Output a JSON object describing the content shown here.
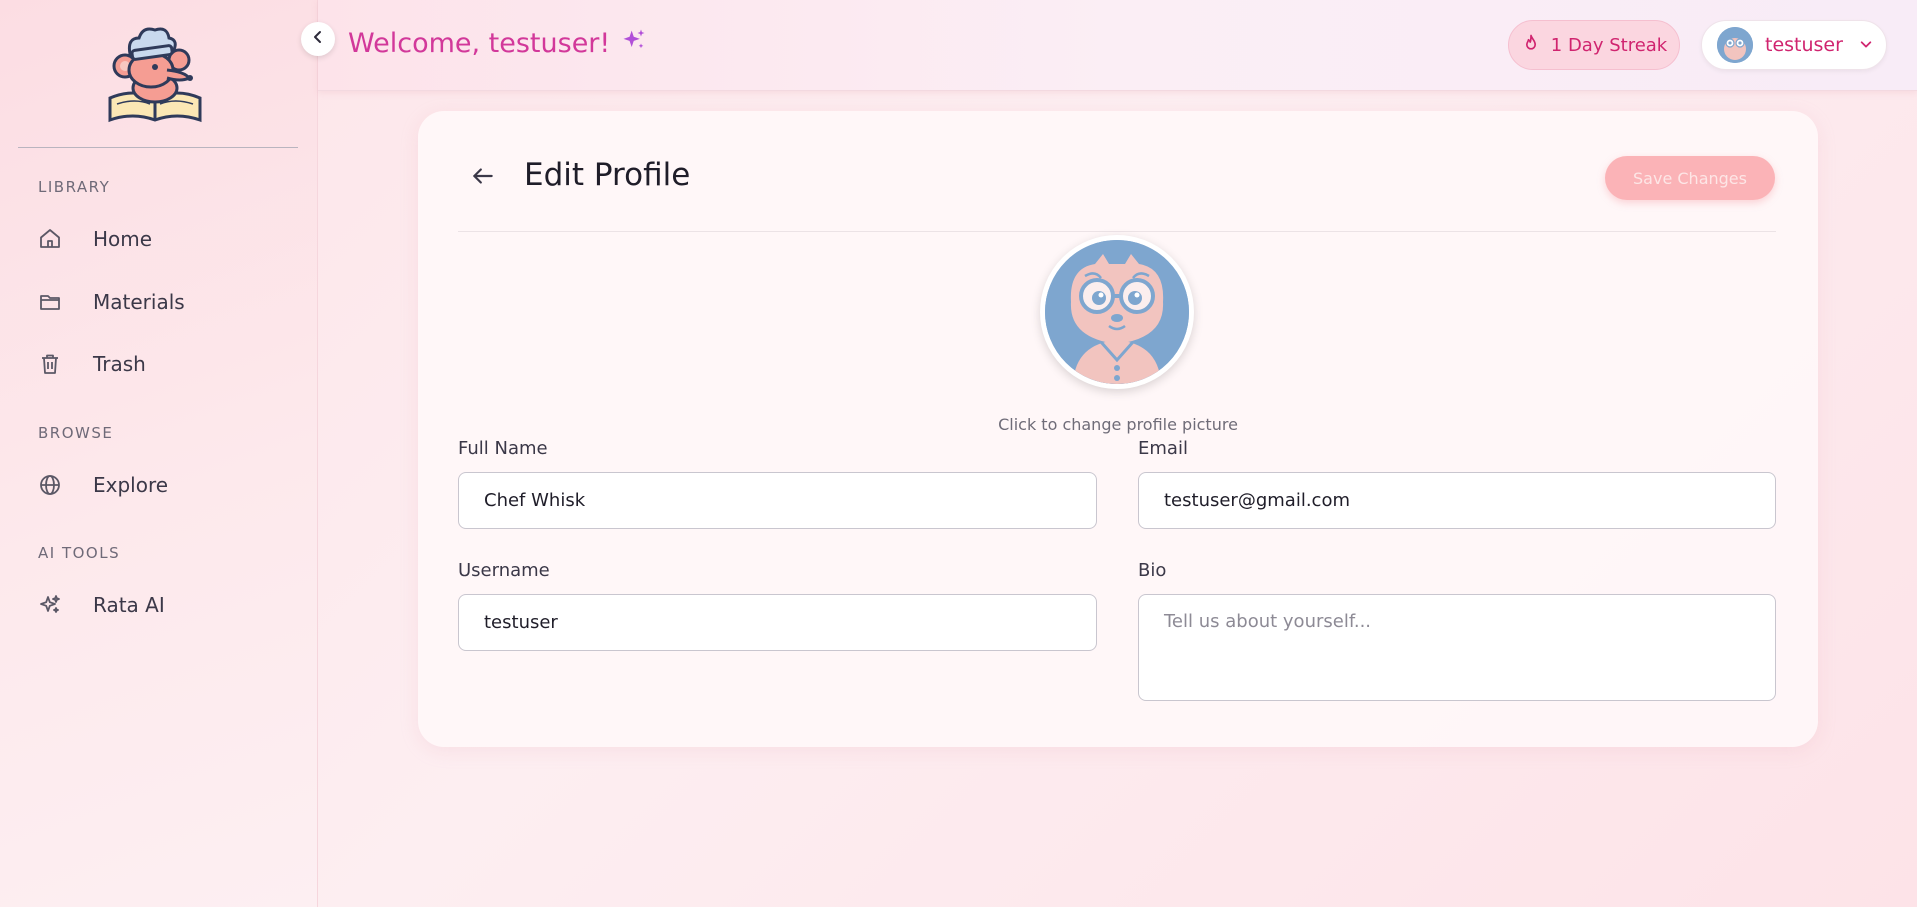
{
  "sidebar": {
    "sections": [
      {
        "label": "LIBRARY",
        "items": [
          {
            "label": "Home",
            "icon": "home-icon"
          },
          {
            "label": "Materials",
            "icon": "folder-icon"
          },
          {
            "label": "Trash",
            "icon": "trash-icon"
          }
        ]
      },
      {
        "label": "BROWSE",
        "items": [
          {
            "label": "Explore",
            "icon": "globe-icon"
          }
        ]
      },
      {
        "label": "AI TOOLS",
        "items": [
          {
            "label": "Rata AI",
            "icon": "sparkles-icon"
          }
        ]
      }
    ]
  },
  "header": {
    "welcome": "Welcome, testuser!",
    "streak": "1 Day Streak",
    "username": "testuser"
  },
  "profile": {
    "title": "Edit Profile",
    "save_label": "Save Changes",
    "avatar_hint": "Click to change profile picture",
    "fields": {
      "full_name": {
        "label": "Full Name",
        "value": "Chef Whisk"
      },
      "email": {
        "label": "Email",
        "value": "testuser@gmail.com"
      },
      "username": {
        "label": "Username",
        "value": "testuser"
      },
      "bio": {
        "label": "Bio",
        "value": "",
        "placeholder": "Tell us about yourself..."
      }
    }
  },
  "colors": {
    "accent": "#d2389a",
    "streak_text": "#d0246f",
    "save_button": "#fbb3b7",
    "avatar_bg": "#7ea6cf"
  }
}
